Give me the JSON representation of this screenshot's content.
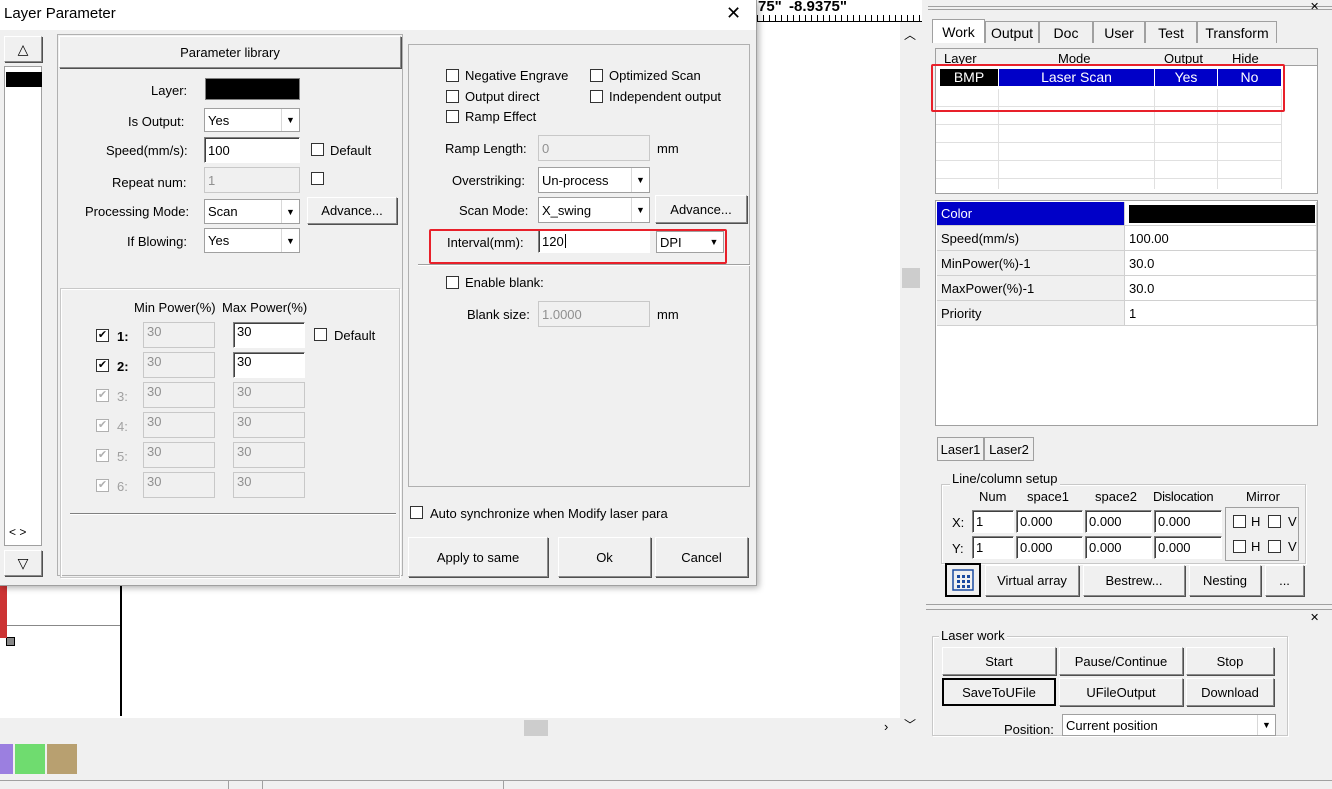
{
  "ruler": {
    "label1": "75\"",
    "label2": "-8.9375\""
  },
  "dialog": {
    "title": "Layer Parameter",
    "close_glyph": "✕",
    "param_library_label": "Parameter library",
    "layer_label": "Layer:",
    "layer_color": "#000000",
    "is_output_label": "Is Output:",
    "is_output_value": "Yes",
    "speed_label": "Speed(mm/s):",
    "speed_value": "100",
    "speed_default_label": "Default",
    "repeat_label": "Repeat num:",
    "repeat_value": "1",
    "processing_mode_label": "Processing Mode:",
    "processing_mode_value": "Scan",
    "advance_label": "Advance...",
    "if_blowing_label": "If Blowing:",
    "if_blowing_value": "Yes",
    "power_header_min": "Min Power(%)",
    "power_header_max": "Max Power(%)",
    "power_default_label": "Default",
    "power_rows": [
      {
        "label": "1:",
        "checked": true,
        "enabled": true,
        "min": "30",
        "max": "30"
      },
      {
        "label": "2:",
        "checked": true,
        "enabled": true,
        "min": "30",
        "max": "30"
      },
      {
        "label": "3:",
        "checked": true,
        "enabled": false,
        "min": "30",
        "max": "30"
      },
      {
        "label": "4:",
        "checked": true,
        "enabled": false,
        "min": "30",
        "max": "30"
      },
      {
        "label": "5:",
        "checked": true,
        "enabled": false,
        "min": "30",
        "max": "30"
      },
      {
        "label": "6:",
        "checked": true,
        "enabled": false,
        "min": "30",
        "max": "30"
      }
    ],
    "negative_engrave_label": "Negative Engrave",
    "optimized_scan_label": "Optimized Scan",
    "output_direct_label": "Output direct",
    "independent_output_label": "Independent output",
    "ramp_effect_label": "Ramp Effect",
    "ramp_length_label": "Ramp Length:",
    "ramp_length_value": "0",
    "mm_unit": "mm",
    "overstriking_label": "Overstriking:",
    "overstriking_value": "Un-process",
    "scan_mode_label": "Scan Mode:",
    "scan_mode_value": "X_swing",
    "scan_advance_label": "Advance...",
    "interval_label": "Interval(mm):",
    "interval_value": "120",
    "interval_unit_value": "DPI",
    "enable_blank_label": "Enable blank:",
    "blank_size_label": "Blank size:",
    "blank_size_value": "1.0000",
    "auto_sync_label": "Auto synchronize when Modify laser para",
    "apply_to_same_label": "Apply to same",
    "ok_label": "Ok",
    "cancel_label": "Cancel",
    "left_nav_arrows": "< >"
  },
  "right_panel": {
    "tabs": [
      "Work",
      "Output",
      "Doc",
      "User",
      "Test",
      "Transform"
    ],
    "layer_table": {
      "headers": [
        "Layer",
        "Mode",
        "Output",
        "Hide"
      ],
      "rows": [
        {
          "layer": "BMP",
          "mode": "Laser Scan",
          "output": "Yes",
          "hide": "No"
        }
      ]
    },
    "props": [
      {
        "name": "Color",
        "value": ""
      },
      {
        "name": "Speed(mm/s)",
        "value": "100.00"
      },
      {
        "name": "MinPower(%)-1",
        "value": "30.0"
      },
      {
        "name": "MaxPower(%)-1",
        "value": "30.0"
      },
      {
        "name": "Priority",
        "value": "1"
      }
    ],
    "laser_tabs": [
      "Laser1",
      "Laser2"
    ],
    "line_column": {
      "title": "Line/column setup",
      "headers": {
        "num": "Num",
        "space1": "space1",
        "space2": "space2",
        "dislocation": "Dislocation",
        "mirror": "Mirror"
      },
      "x_label": "X:",
      "y_label": "Y:",
      "x": {
        "num": "1",
        "space1": "0.000",
        "space2": "0.000",
        "dislocation": "0.000"
      },
      "y": {
        "num": "1",
        "space1": "0.000",
        "space2": "0.000",
        "dislocation": "0.000"
      },
      "h_label": "H",
      "v_label": "V"
    },
    "array_buttons": {
      "virtual": "Virtual array",
      "bestrew": "Bestrew...",
      "nesting": "Nesting",
      "more": "..."
    },
    "laser_work": {
      "title": "Laser work",
      "start": "Start",
      "pause": "Pause/Continue",
      "stop": "Stop",
      "save_u": "SaveToUFile",
      "ufile_output": "UFileOutput",
      "download": "Download",
      "position_label": "Position:",
      "position_value": "Current position"
    }
  },
  "palette": {
    "colors": [
      "#9b7fe0",
      "#6fdc6f",
      "#b8a070"
    ]
  }
}
